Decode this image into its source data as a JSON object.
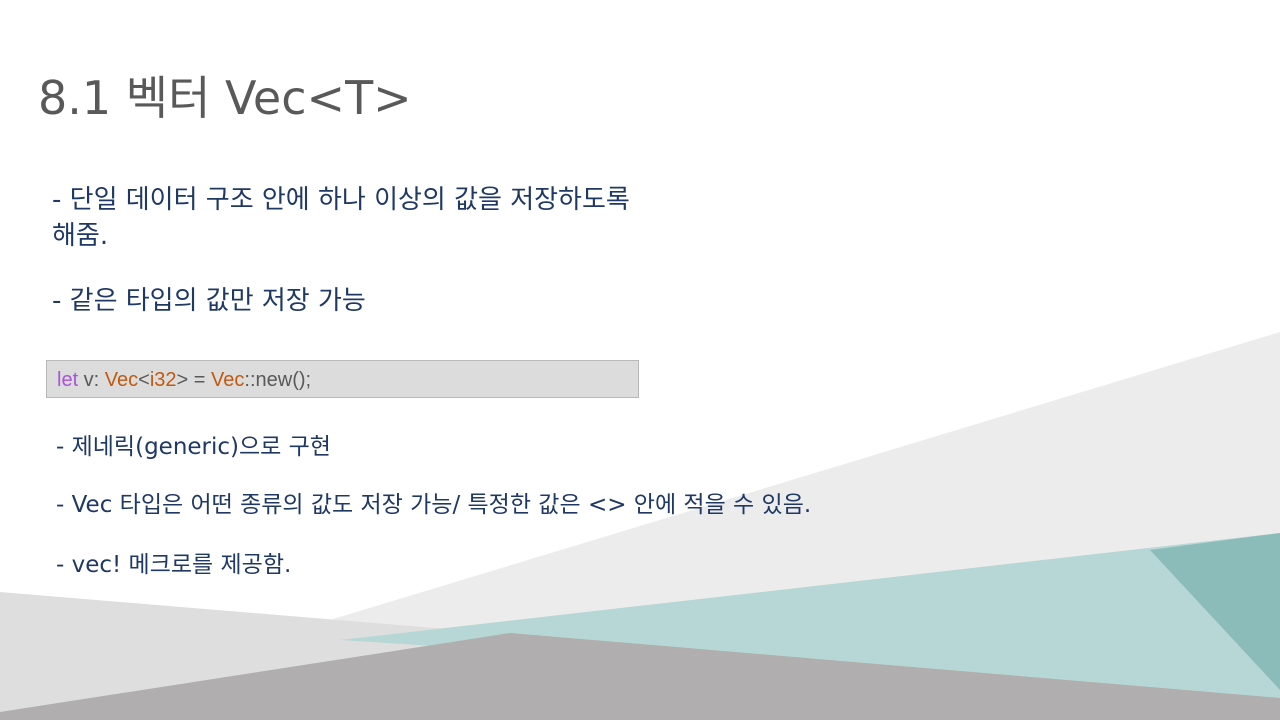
{
  "slide": {
    "title": "8.1 벡터 Vec<T>",
    "bullets_top": [
      {
        "line1": "- 단일 데이터 구조 안에 하나 이상의 값을 저장하도록",
        "line2": "해줌."
      },
      {
        "line1": "- 같은 타입의 값만 저장 가능"
      }
    ],
    "code": {
      "tokens": [
        {
          "text": "let",
          "color": "#a855d8"
        },
        {
          "text": " v: ",
          "color": "#595959"
        },
        {
          "text": "Vec",
          "color": "#c05a12"
        },
        {
          "text": "<",
          "color": "#595959"
        },
        {
          "text": "i32",
          "color": "#c05a12"
        },
        {
          "text": "> = ",
          "color": "#595959"
        },
        {
          "text": "Vec",
          "color": "#c05a12"
        },
        {
          "text": "::new();",
          "color": "#595959"
        }
      ]
    },
    "bullets_bottom": [
      "- 제네릭(generic)으로 구현",
      "- Vec 타입은 어떤 종류의 값도 저장 가능/ 특정한 값은 <> 안에 적을 수 있음.",
      "- vec! 메크로를 제공함."
    ]
  },
  "colors": {
    "text": "#1f3864",
    "title": "#595959",
    "code_bg": "#dcdcdc",
    "teal_dark": "#8cbcb9",
    "teal_light": "#b6d7d5",
    "gray_light": "#ececec",
    "gray_dark": "#b0aeae"
  }
}
